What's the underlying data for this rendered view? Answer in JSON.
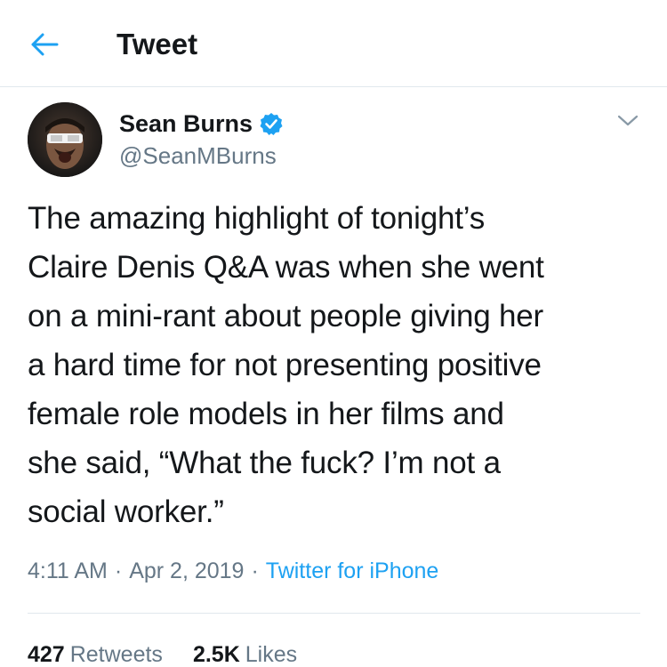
{
  "header": {
    "title": "Tweet",
    "back_icon": "arrow-left-icon"
  },
  "author": {
    "display_name": "Sean Burns",
    "handle": "@SeanMBurns",
    "verified": true
  },
  "tweet": {
    "lines": [
      "The amazing highlight of tonight’s",
      "Claire Denis Q&A was when she went",
      "on a mini-rant about people giving her",
      "a hard time for not presenting positive",
      "female role models in her films and",
      "she said, “What the fuck? I’m not a",
      "social worker.”"
    ],
    "time": "4:11 AM",
    "date": "Apr 2, 2019",
    "separator": "·",
    "source": "Twitter for iPhone"
  },
  "stats": {
    "retweets_count": "427",
    "retweets_label": "Retweets",
    "likes_count": "2.5K",
    "likes_label": "Likes"
  },
  "colors": {
    "accent": "#1da1f2",
    "text": "#14171a",
    "muted": "#657786",
    "divider": "#e1e8ed"
  }
}
